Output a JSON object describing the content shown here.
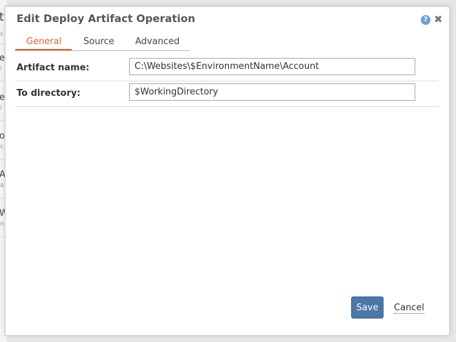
{
  "dialog": {
    "title": "Edit Deploy Artifact Operation",
    "help_icon": "?",
    "close_icon": "✖"
  },
  "tabs": [
    {
      "label": "General",
      "active": true
    },
    {
      "label": "Source",
      "active": false
    },
    {
      "label": "Advanced",
      "active": false
    }
  ],
  "fields": [
    {
      "label": "Artifact name:",
      "value": "C:\\Websites\\$EnvironmentName\\Account"
    },
    {
      "label": "To directory:",
      "value": "$WorkingDirectory"
    }
  ],
  "actions": {
    "save_label": "Save",
    "cancel_label": "Cancel"
  },
  "background_glyphs": [
    "t",
    "s",
    "e",
    "i",
    "o",
    "c",
    "A",
    "a",
    "W",
    "n"
  ],
  "colors": {
    "accent": "#e0632b",
    "primary_button": "#4b76a8",
    "help_icon": "#6ba0d8"
  }
}
